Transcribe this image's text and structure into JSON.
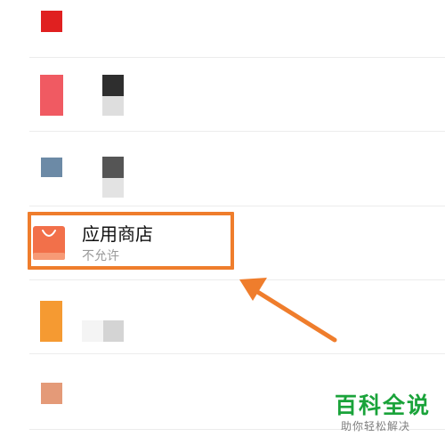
{
  "list": {
    "highlighted_item": {
      "name": "应用商店",
      "status": "不允许",
      "icon": "shopping-bag-icon",
      "icon_color": "#f2704a"
    }
  },
  "annotation": {
    "highlight_color": "#ef7d2c",
    "arrow_color": "#ef7d2c"
  },
  "watermark": {
    "title": "百科全说",
    "subtitle": "助你轻松解决",
    "color": "#1aa33a"
  }
}
